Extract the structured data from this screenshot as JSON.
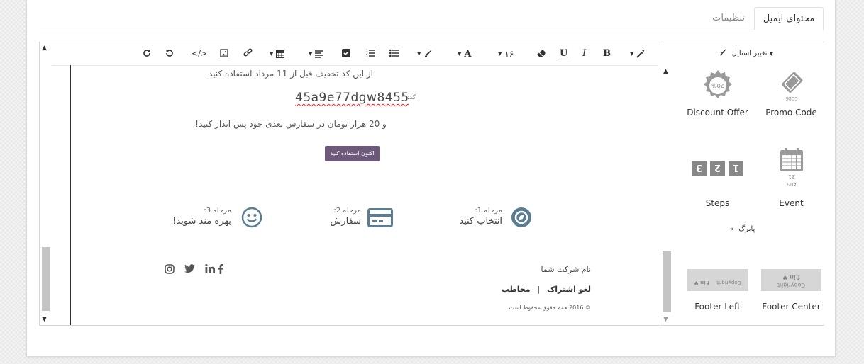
{
  "tabs": {
    "active": "محتوای ایمیل",
    "inactive": "تنظیمات"
  },
  "toolbar": {
    "font_size": "۱۶",
    "font_color_glyph": "A",
    "bold_glyph": "B",
    "italic_glyph": "I",
    "underline_glyph": "U"
  },
  "email": {
    "intro": "از این کد تخفیف قبل از 11 مرداد استفاده کنید",
    "code_label": "کد:",
    "code": "45a9e77dgw8455",
    "save_text": "و 20 هزار تومان در سفارش بعدی خود پس انداز کنید!",
    "cta": "اکنون استفاده کنید",
    "steps": [
      {
        "label": "مرحله 1:",
        "text": "انتخاب کنید"
      },
      {
        "label": "مرحله 2:",
        "text": "سفارش"
      },
      {
        "label": "مرحله 3:",
        "text": "بهره مند شوید!"
      }
    ],
    "footer": {
      "company": "نام شرکت شما",
      "unsubscribe": "لغو اشتراک",
      "separator": "|",
      "contacts": "مخاطب",
      "copyright": "© 2016 همه حقوق محفوظ است"
    }
  },
  "sidebar": {
    "style_dropdown": "تغییر استایل",
    "snippets": [
      {
        "name": "Promo Code"
      },
      {
        "name": "Discount Offer"
      },
      {
        "name": "Event"
      },
      {
        "name": "Steps"
      },
      {
        "name": "Footer Center"
      },
      {
        "name": "Footer Left"
      }
    ],
    "more_label": "پابرگ",
    "discount_badge": "20%",
    "promo_stamp": "CODE",
    "event_day": "21",
    "event_month": "AUG",
    "steps_digits": [
      "1",
      "2",
      "3"
    ],
    "footer_copy": "Copyright"
  },
  "colors": {
    "accent": "#6d5a7b",
    "icon": "#5a7d92"
  }
}
